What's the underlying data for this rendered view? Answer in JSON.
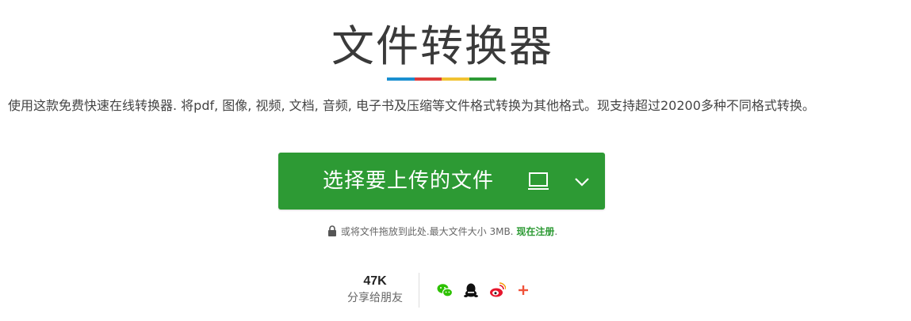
{
  "header": {
    "title": "文件转换器",
    "accent_colors": [
      "#1a8fd0",
      "#dd3b3b",
      "#f1c232",
      "#2d9a34"
    ],
    "description": "使用这款免费快速在线转换器. 将pdf, 图像, 视频, 文档, 音频, 电子书及压缩等文件格式转换为其他格式。现支持超过20200多种不同格式转换。"
  },
  "upload": {
    "button_label": "选择要上传的文件",
    "button_color": "#2d9a34",
    "icons": [
      "folder-icon",
      "chevron-down-icon"
    ]
  },
  "note": {
    "text": "或将文件拖放到此处.最大文件大小 3MB.",
    "register_link": "现在注册",
    "suffix": "."
  },
  "share": {
    "count": "47K",
    "label": "分享给朋友",
    "icons": [
      "wechat-icon",
      "qq-icon",
      "weibo-icon",
      "plus-icon"
    ]
  }
}
